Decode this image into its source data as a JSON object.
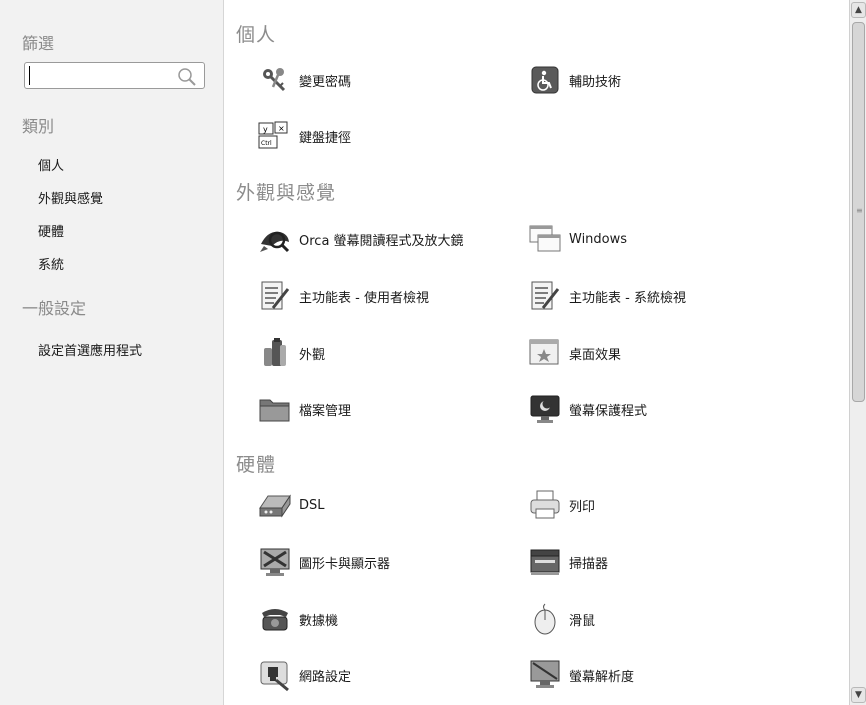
{
  "sidebar": {
    "filter_heading": "篩選",
    "search": {
      "value": "",
      "placeholder": ""
    },
    "category_heading": "類別",
    "categories": [
      "個人",
      "外觀與感覺",
      "硬體",
      "系統"
    ],
    "general_heading": "一般設定",
    "general_item": "設定首選應用程式"
  },
  "sections": {
    "personal": {
      "title": "個人",
      "items": [
        {
          "label": "變更密碼",
          "icon": "keys-icon"
        },
        {
          "label": "輔助技術",
          "icon": "accessibility-icon"
        },
        {
          "label": "鍵盤捷徑",
          "icon": "keyboard-shortcut-icon"
        }
      ]
    },
    "look": {
      "title": "外觀與感覺",
      "items": [
        {
          "label": "Orca 螢幕閱讀程式及放大鏡",
          "icon": "orca-icon"
        },
        {
          "label": "Windows",
          "icon": "windows-icon"
        },
        {
          "label": "主功能表 - 使用者檢視",
          "icon": "menu-user-view-icon"
        },
        {
          "label": "主功能表 - 系統檢視",
          "icon": "menu-system-view-icon"
        },
        {
          "label": "外觀",
          "icon": "appearance-icon"
        },
        {
          "label": "桌面效果",
          "icon": "desktop-effects-icon"
        },
        {
          "label": "檔案管理",
          "icon": "folder-icon"
        },
        {
          "label": "螢幕保護程式",
          "icon": "screensaver-icon"
        }
      ]
    },
    "hardware": {
      "title": "硬體",
      "items": [
        {
          "label": "DSL",
          "icon": "dsl-icon"
        },
        {
          "label": "列印",
          "icon": "printer-icon"
        },
        {
          "label": "圖形卡與顯示器",
          "icon": "display-icon"
        },
        {
          "label": "掃描器",
          "icon": "scanner-icon"
        },
        {
          "label": "數據機",
          "icon": "modem-icon"
        },
        {
          "label": "滑鼠",
          "icon": "mouse-icon"
        },
        {
          "label": "網路設定",
          "icon": "network-icon"
        },
        {
          "label": "螢幕解析度",
          "icon": "resolution-icon"
        }
      ]
    }
  }
}
